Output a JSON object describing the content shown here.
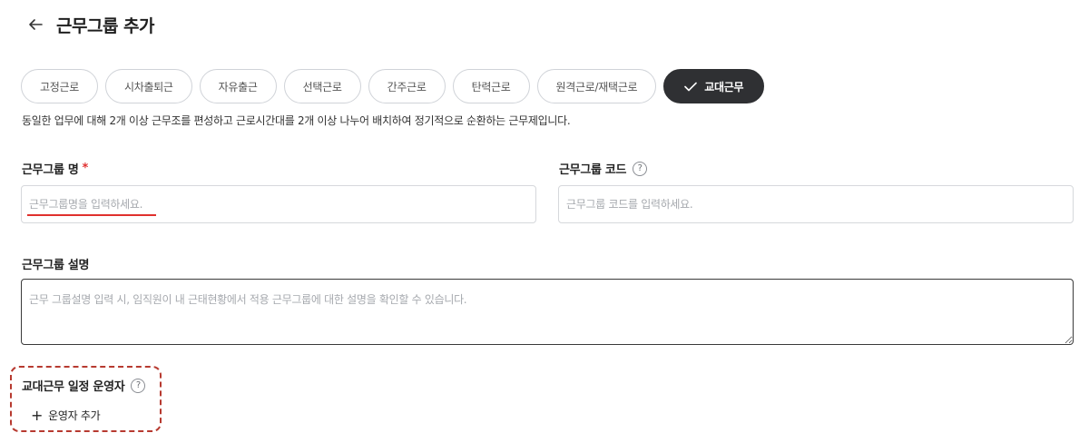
{
  "header": {
    "title": "근무그룹 추가"
  },
  "tabs": [
    {
      "label": "고정근로",
      "active": false
    },
    {
      "label": "시차출퇴근",
      "active": false
    },
    {
      "label": "자유출근",
      "active": false
    },
    {
      "label": "선택근로",
      "active": false
    },
    {
      "label": "간주근로",
      "active": false
    },
    {
      "label": "탄력근로",
      "active": false
    },
    {
      "label": "원격근로/재택근로",
      "active": false
    },
    {
      "label": "교대근무",
      "active": true
    }
  ],
  "tab_description": "동일한 업무에 대해 2개 이상 근무조를 편성하고 근로시간대를 2개 이상 나누어 배치하여 정기적으로 순환하는 근무제입니다.",
  "form": {
    "group_name": {
      "label": "근무그룹 명",
      "required_mark": "*",
      "placeholder": "근무그룹명을 입력하세요.",
      "value": ""
    },
    "group_code": {
      "label": "근무그룹 코드",
      "help": "?",
      "placeholder": "근무그룹 코드를 입력하세요.",
      "value": ""
    },
    "group_desc": {
      "label": "근무그룹 설명",
      "placeholder": "근무 그룹설명 입력 시, 임직원이 내 근태현황에서 적용 근무그룹에 대한 설명을 확인할 수 있습니다.",
      "value": ""
    }
  },
  "operators": {
    "label": "교대근무 일정 운영자",
    "help": "?",
    "add_symbol": "+",
    "add_label": "운영자 추가"
  },
  "colors": {
    "accent_dark": "#2f3033",
    "required": "#e03131",
    "highlight": "#b73a30"
  }
}
